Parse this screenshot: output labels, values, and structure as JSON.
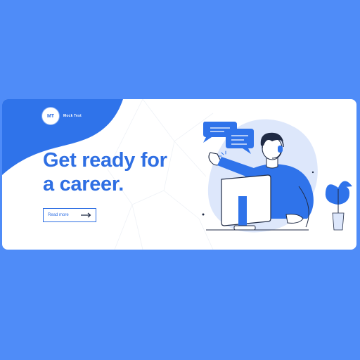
{
  "brand": {
    "logo_initials": "MT",
    "name": "Mock Test"
  },
  "hero": {
    "headline_line1": "Get ready for",
    "headline_line2": "a career."
  },
  "cta": {
    "label": "Read more"
  },
  "colors": {
    "page_background": "#4f8cf8",
    "accent": "#2f6fe3",
    "light_accent": "#dde7fb",
    "banner_background": "#ffffff"
  },
  "illustration": {
    "subject": "person-at-computer-with-headset",
    "icons": [
      "speech-bubble-icon",
      "chat-bubble-icon",
      "plant-icon",
      "monitor-icon"
    ]
  }
}
